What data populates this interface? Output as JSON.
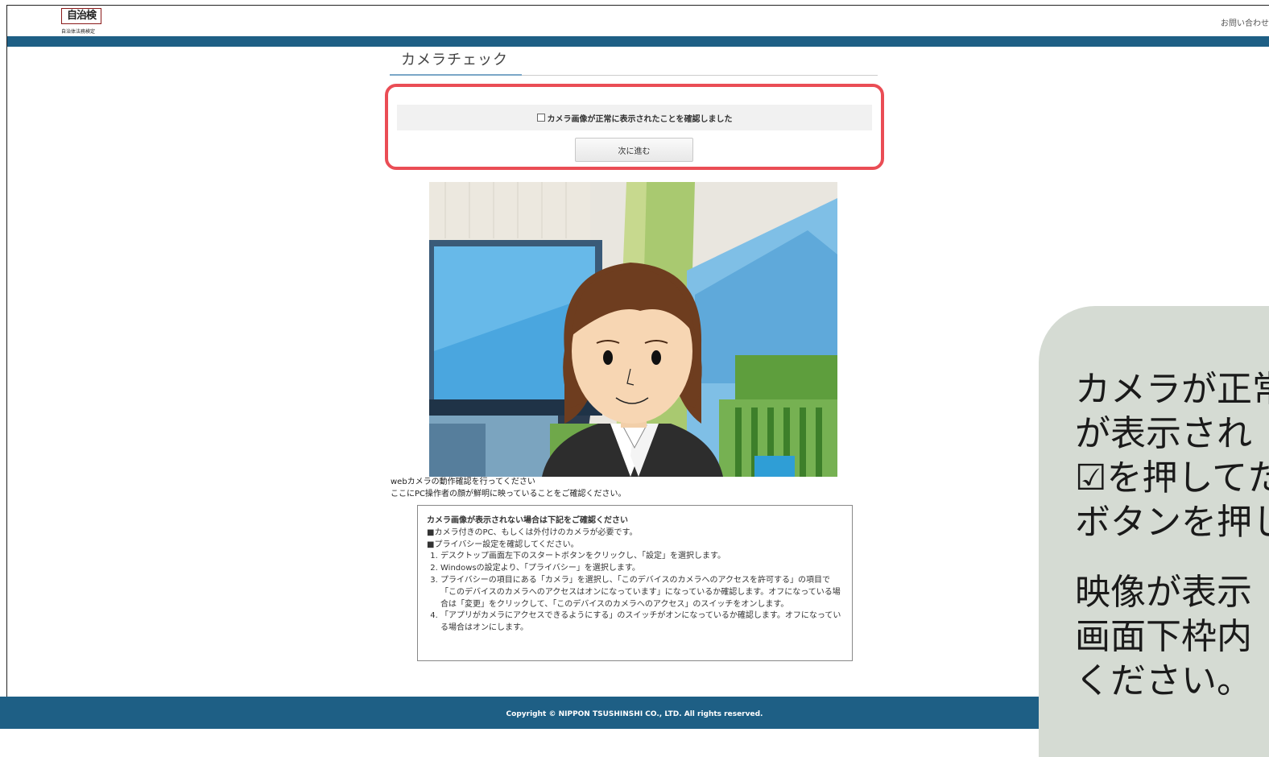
{
  "header": {
    "logo_text": "自治検",
    "logo_sub": "自治体法務検定",
    "contact_link": "お問い合わせ"
  },
  "page": {
    "title": "カメラチェック"
  },
  "confirm": {
    "checkbox_label": "カメラ画像が正常に表示されたことを確認しました",
    "next_button": "次に進む"
  },
  "caption": {
    "line1": "webカメラの動作確認を行ってください",
    "line2": "ここにPC操作者の顔が鮮明に映っていることをご確認ください。"
  },
  "help": {
    "title": "カメラ画像が表示されない場合は下記をご確認ください",
    "bullet1": "■カメラ付きのPC、もしくは外付けのカメラが必要です。",
    "bullet2": "■プライバシー設定を確認してください。",
    "steps": [
      "デスクトップ画面左下のスタートボタンをクリックし、「設定」を選択します。",
      "Windowsの設定より、「プライバシー」を選択します。",
      "プライバシーの項目にある「カメラ」を選択し、「このデバイスのカメラへのアクセスを許可する」の項目で「このデバイスのカメラへのアクセスはオンになっています」になっているか確認します。オフになっている場合は「変更」をクリックして、「このデバイスのカメラへのアクセス」のスイッチをオンします。",
      "「アプリがカメラにアクセスできるようにする」のスイッチがオンになっているか確認します。オフになっている場合はオンにします。"
    ]
  },
  "footer": {
    "copyright": "Copyright © NIPPON TSUSHINSHI CO., LTD. All rights reserved."
  },
  "callout": {
    "lines": [
      "カメラが正常",
      "が表示され",
      "☑を押してた",
      "ボタンを押し"
    ],
    "lines2": [
      "映像が表示",
      "画面下枠内",
      "ください。"
    ]
  },
  "colors": {
    "nav": "#1e5f85",
    "highlight": "#ea4d55",
    "callout_bg": "#d5dbd3"
  }
}
